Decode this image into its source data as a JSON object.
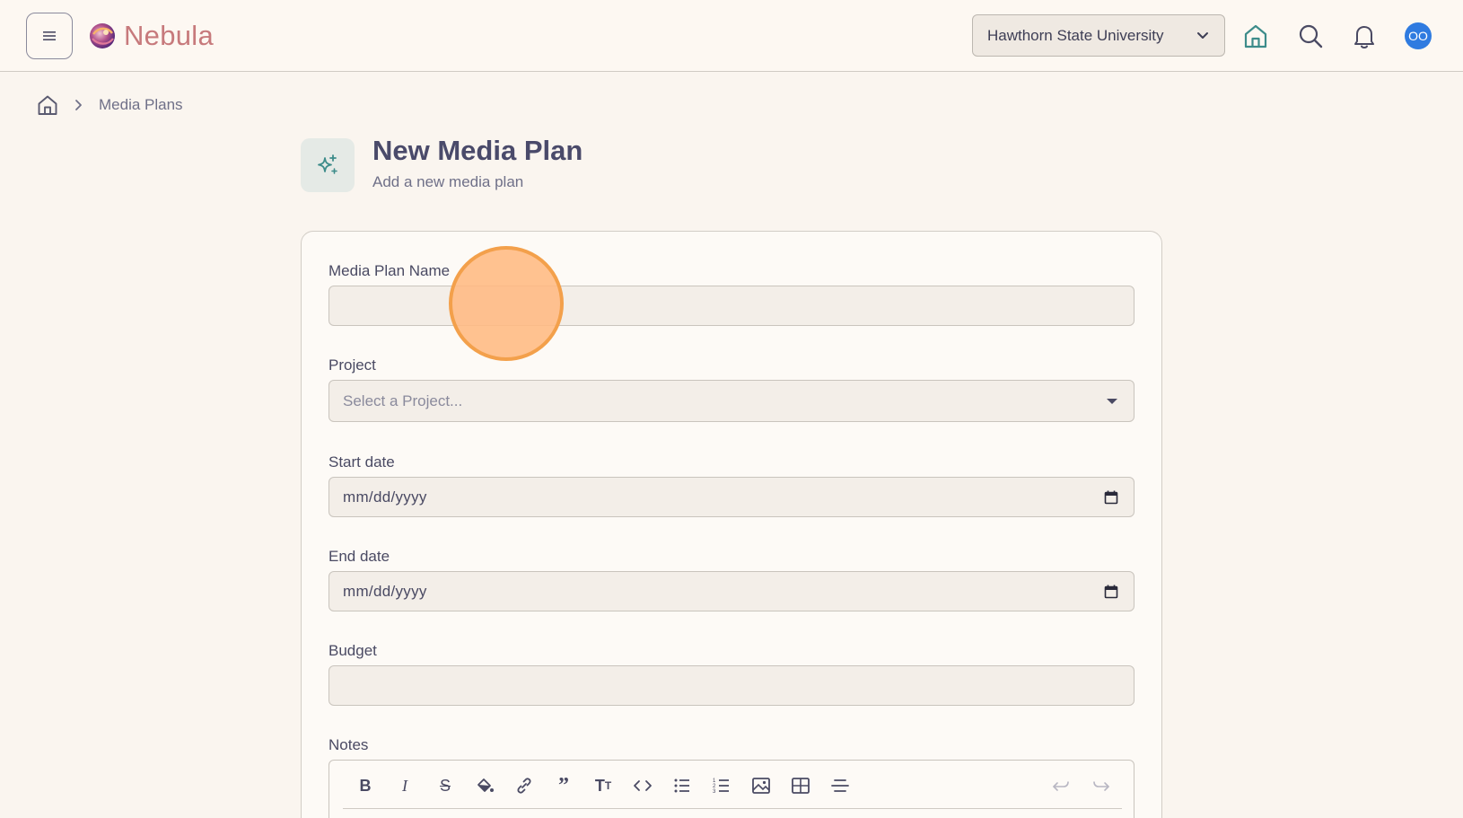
{
  "app": {
    "name": "Nebula",
    "org_selector": "Hawthorn State University",
    "user_initials": "OO",
    "avatar_color": "#2f7be0",
    "brand_color": "#c77a7c"
  },
  "topbar_icons": [
    "menu-icon",
    "home-icon",
    "search-icon",
    "bell-icon"
  ],
  "breadcrumb": {
    "items": [
      "Media Plans"
    ]
  },
  "header": {
    "title": "New Media Plan",
    "subtitle": "Add a new media plan"
  },
  "form": {
    "name_label": "Media Plan Name",
    "name_value": "",
    "project_label": "Project",
    "project_placeholder": "Select a Project...",
    "start_label": "Start date",
    "start_value": "mm/dd/yyyy",
    "end_label": "End date",
    "end_value": "mm/dd/yyyy",
    "budget_label": "Budget",
    "budget_value": "",
    "notes_label": "Notes"
  },
  "editor_toolbar": [
    "bold-icon",
    "italic-icon",
    "strikethrough-icon",
    "highlight-icon",
    "link-icon",
    "quote-icon",
    "text-size-icon",
    "code-icon",
    "bullet-list-icon",
    "numbered-list-icon",
    "image-icon",
    "table-icon",
    "horizontal-rule-icon",
    "undo-icon",
    "redo-icon"
  ]
}
